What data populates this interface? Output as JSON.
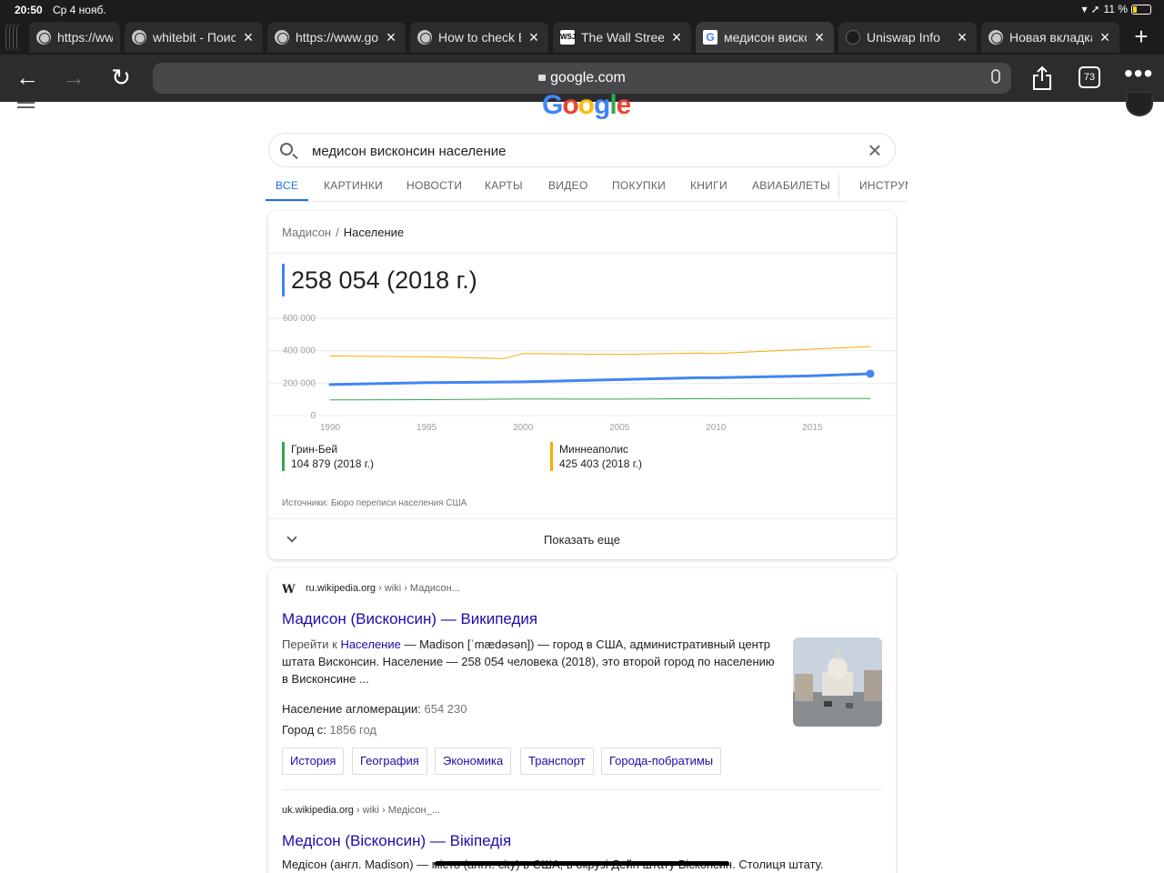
{
  "status_bar": {
    "time": "20:50",
    "date": "Ср 4 нояб.",
    "battery": "11 %"
  },
  "tabs": [
    {
      "title": "https://www.",
      "favicon": "globe-icon"
    },
    {
      "title": "whitebit - Поиск",
      "favicon": "globe-icon"
    },
    {
      "title": "https://www.goo",
      "favicon": "globe-icon"
    },
    {
      "title": "How to check E",
      "favicon": "globe-icon"
    },
    {
      "title": "The Wall Street",
      "favicon": "wsj-icon",
      "favicon_text": "WSJ"
    },
    {
      "title": "медисон виско",
      "favicon": "google-icon",
      "favicon_text": "G"
    },
    {
      "title": "Uniswap Info",
      "favicon": "uniswap-icon"
    },
    {
      "title": "Новая вкладка",
      "favicon": "globe-icon"
    }
  ],
  "toolbar": {
    "url": "google.com",
    "tab_count": "73"
  },
  "search": {
    "query": "медисон висконсин население"
  },
  "search_tabs": [
    "ВСЕ",
    "КАРТИНКИ",
    "НОВОСТИ",
    "КАРТЫ",
    "ВИДЕО",
    "ПОКУПКИ",
    "КНИГИ",
    "АВИАБИЛЕТЫ",
    "ИНСТРУМ"
  ],
  "population_card": {
    "breadcrumb_parent": "Мадисон",
    "breadcrumb_sep": "/",
    "breadcrumb_current": "Население",
    "value": "258 054 (2018 г.)",
    "legend": [
      {
        "name": "Грин-Бей",
        "value": "104 879 (2018 г.)"
      },
      {
        "name": "Миннеаполис",
        "value": "425 403 (2018 г.)"
      }
    ],
    "sources": "Источники: Бюро переписи населения США",
    "show_more": "Показать еще"
  },
  "chart_data": {
    "type": "line",
    "title": "",
    "xlabel": "",
    "ylabel": "",
    "xlim": [
      1990,
      2018
    ],
    "ylim": [
      0,
      600000
    ],
    "x_ticks": [
      1990,
      1995,
      2000,
      2005,
      2010,
      2015
    ],
    "x_tick_labels": [
      "1990",
      "1995",
      "2000",
      "2005",
      "2010",
      "2015"
    ],
    "y_ticks": [
      0,
      200000,
      400000,
      600000
    ],
    "y_tick_labels": [
      "0",
      "200 000",
      "400 000",
      "600 000"
    ],
    "grid": true,
    "series": [
      {
        "name": "Мадисон",
        "color": "#4285f4",
        "x": [
          1990,
          1995,
          2000,
          2005,
          2009,
          2010,
          2015,
          2018
        ],
        "y": [
          191000,
          203000,
          208000,
          222000,
          233000,
          233500,
          245000,
          258054
        ]
      },
      {
        "name": "Грин-Бей",
        "color": "#34a853",
        "x": [
          1990,
          1995,
          2000,
          2005,
          2010,
          2015,
          2018
        ],
        "y": [
          96500,
          98000,
          102300,
          101500,
          104100,
          105000,
          104879
        ]
      },
      {
        "name": "Миннеаполис",
        "color": "#f9ab00",
        "x": [
          1990,
          1995,
          1999,
          2000,
          2005,
          2009,
          2010,
          2015,
          2018
        ],
        "y": [
          368000,
          362000,
          352000,
          382600,
          377000,
          385000,
          382600,
          410000,
          425403
        ]
      }
    ]
  },
  "result1": {
    "site": "ru.wikipedia.org",
    "path": " › wiki › Мадисон...",
    "title": "Мадисон (Висконсин) — Википедия",
    "snippet_prefix": "Перейти к ",
    "snippet_link": "Население",
    "snippet_body": " — Madison [ˈmædəsən]) — город в США, административный центр штата Висконсин. Население — 258 054 человека (2018), это второй город по населению в Висконсине ...",
    "fact1_label": "Население агломерации: ",
    "fact1_value": "654 230",
    "fact2_label": "Город с: ",
    "fact2_value": "1856 год",
    "chips": [
      "История",
      "География",
      "Экономика",
      "Транспорт",
      "Города-побратимы"
    ]
  },
  "result2": {
    "site": "uk.wikipedia.org",
    "path": " › wiki › Медісон_...",
    "title": "Медісон (Вісконсин) — Вікіпедія",
    "snippet": "Медісон (англ. Madison) — місто (англ. city) в США, в окрузі Дейн штату Вісконсин. Столиця штату."
  }
}
